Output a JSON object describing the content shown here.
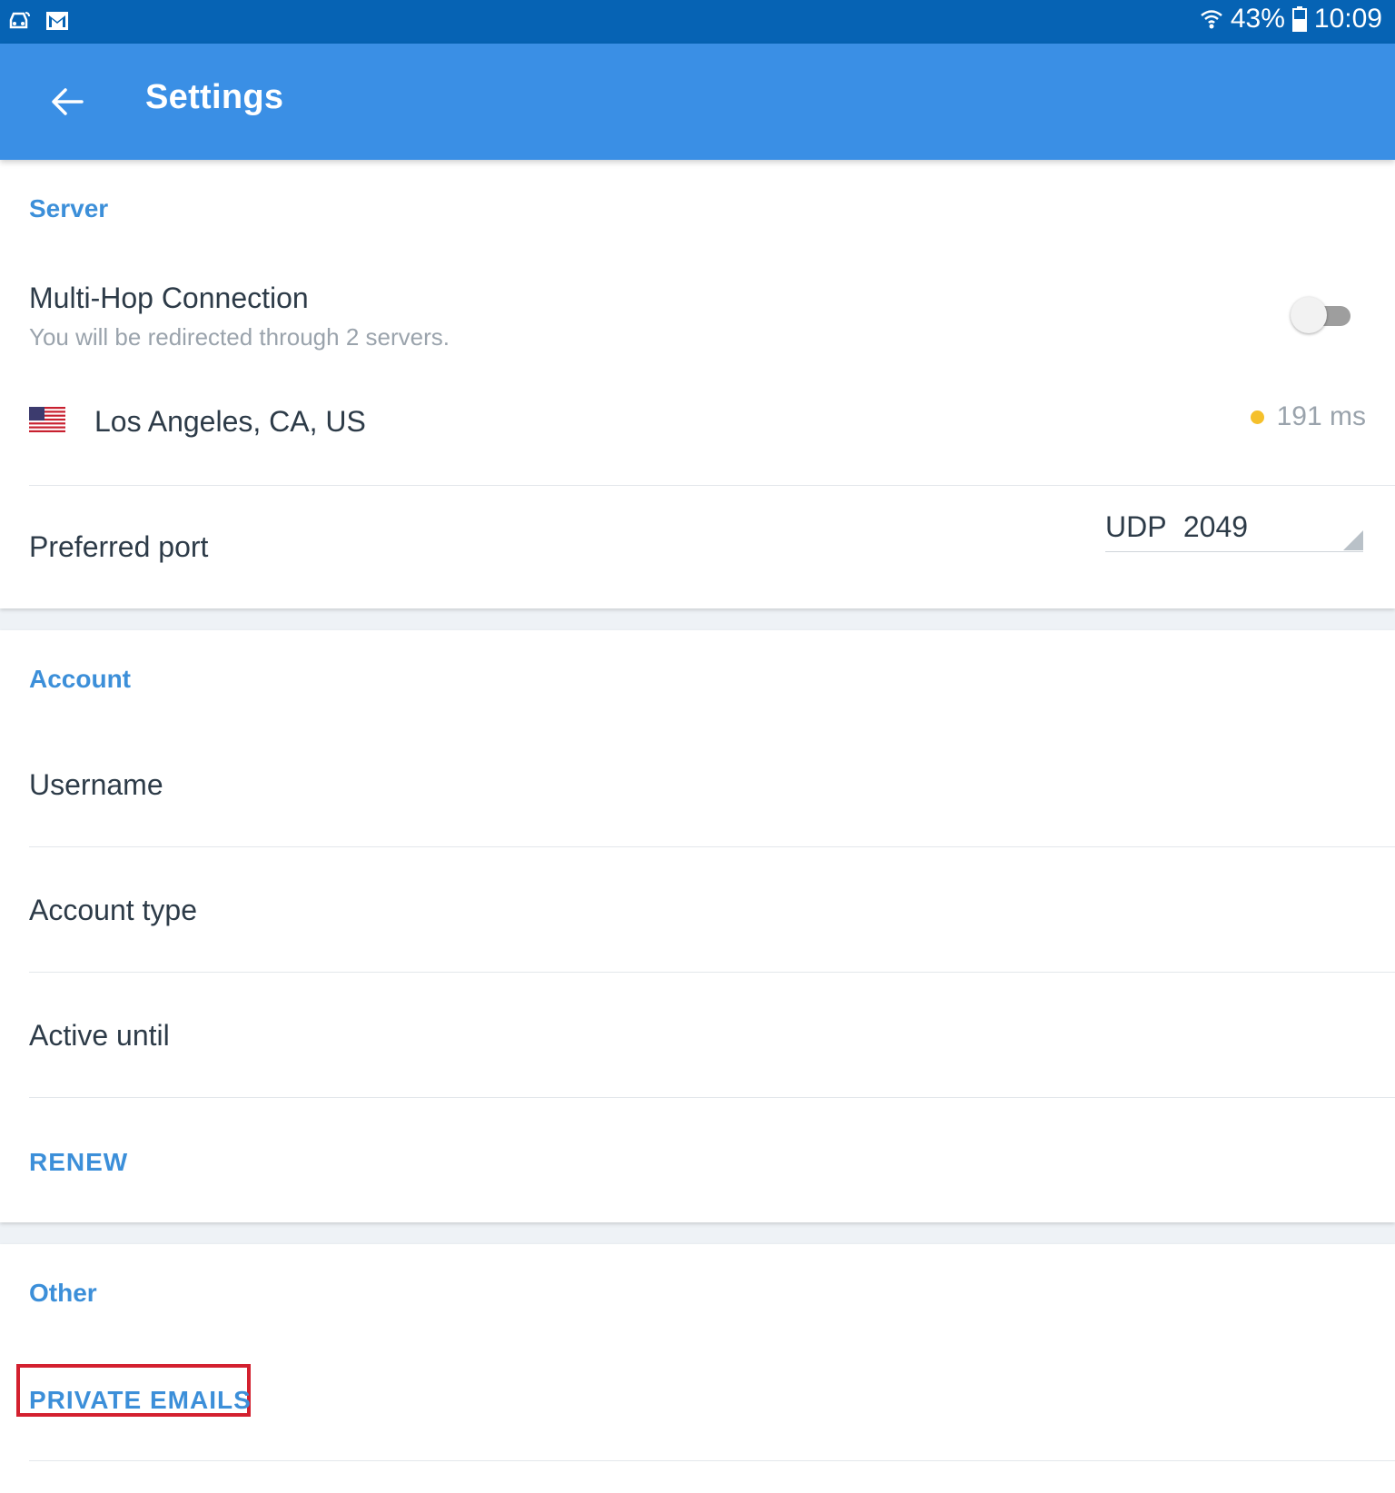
{
  "status_bar": {
    "icons_left": [
      "car-icon",
      "mail-icon"
    ],
    "battery_percent": "43%",
    "time": "10:09"
  },
  "app_bar": {
    "title": "Settings",
    "back_icon": "arrow-left-icon"
  },
  "server": {
    "section_title": "Server",
    "multihop": {
      "label": "Multi-Hop Connection",
      "subtitle": "You will be redirected through 2 servers.",
      "enabled": false
    },
    "location": {
      "name": "Los Angeles, CA, US",
      "flag": "us-flag-icon",
      "ping": "191 ms",
      "ping_color": "#f5c02b"
    },
    "preferred_port": {
      "label": "Preferred port",
      "value": "UDP 2049"
    }
  },
  "account": {
    "section_title": "Account",
    "rows": {
      "username": "Username",
      "account_type": "Account type",
      "active_until": "Active until"
    },
    "renew": "RENEW"
  },
  "other": {
    "section_title": "Other",
    "private_emails": "PRIVATE EMAILS"
  },
  "colors": {
    "status_bar": "#0663b4",
    "app_bar": "#3a8fe5",
    "accent": "#3c8fd9",
    "highlight": "#d3202f"
  }
}
